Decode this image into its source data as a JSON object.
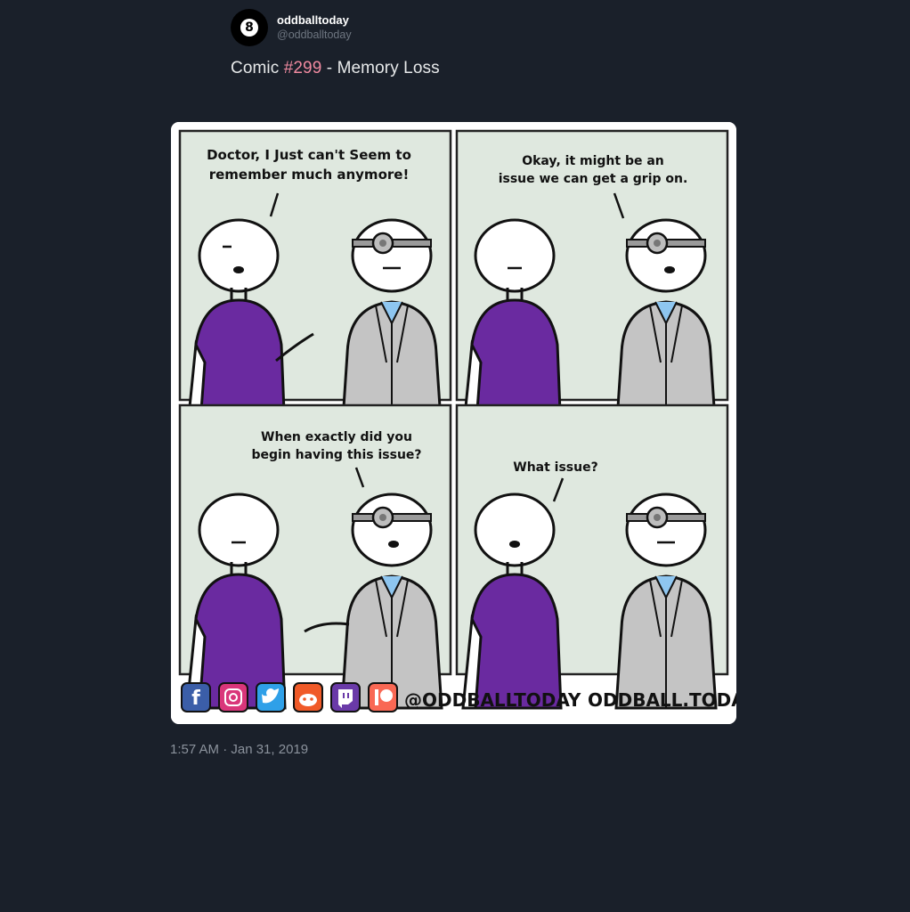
{
  "account": {
    "display_name": "oddballtoday",
    "handle": "@oddballtoday",
    "avatar_glyph": "8"
  },
  "tweet": {
    "prefix": "Comic ",
    "hashtag": "#299",
    "suffix": " - Memory Loss",
    "timestamp": "1:57 AM · Jan 31, 2019"
  },
  "comic": {
    "panel1": {
      "line1": "Doctor, I Just can't Seem to",
      "line2": "remember much anymore!"
    },
    "panel2": {
      "line1": "Okay, it might be an",
      "line2": "issue we can get a grip on."
    },
    "panel3": {
      "line1": "When exactly did you",
      "line2": "begin having this issue?"
    },
    "panel4": {
      "line1": "What issue?"
    },
    "footer": {
      "handle": "@ODDBALLTODAY",
      "site": "ODDBALL.TODAY",
      "social_icons": [
        "facebook-icon",
        "instagram-icon",
        "twitter-icon",
        "reddit-icon",
        "twitch-icon",
        "patreon-icon"
      ]
    }
  },
  "colors": {
    "background": "#1a202a",
    "hashtag": "#f08aa0",
    "patient_shirt": "#6a2aa0",
    "panel_bg": "#dfe8df",
    "coat": "#c4c4c4"
  }
}
